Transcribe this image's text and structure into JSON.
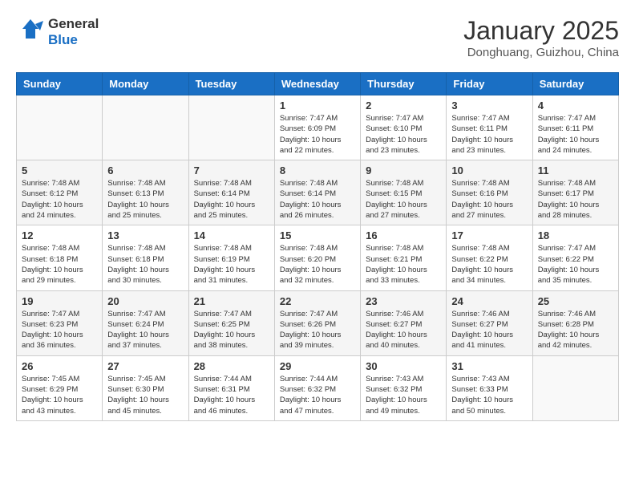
{
  "header": {
    "logo_line1": "General",
    "logo_line2": "Blue",
    "month_year": "January 2025",
    "location": "Donghuang, Guizhou, China"
  },
  "days_of_week": [
    "Sunday",
    "Monday",
    "Tuesday",
    "Wednesday",
    "Thursday",
    "Friday",
    "Saturday"
  ],
  "weeks": [
    [
      {
        "day": "",
        "info": ""
      },
      {
        "day": "",
        "info": ""
      },
      {
        "day": "",
        "info": ""
      },
      {
        "day": "1",
        "info": "Sunrise: 7:47 AM\nSunset: 6:09 PM\nDaylight: 10 hours\nand 22 minutes."
      },
      {
        "day": "2",
        "info": "Sunrise: 7:47 AM\nSunset: 6:10 PM\nDaylight: 10 hours\nand 23 minutes."
      },
      {
        "day": "3",
        "info": "Sunrise: 7:47 AM\nSunset: 6:11 PM\nDaylight: 10 hours\nand 23 minutes."
      },
      {
        "day": "4",
        "info": "Sunrise: 7:47 AM\nSunset: 6:11 PM\nDaylight: 10 hours\nand 24 minutes."
      }
    ],
    [
      {
        "day": "5",
        "info": "Sunrise: 7:48 AM\nSunset: 6:12 PM\nDaylight: 10 hours\nand 24 minutes."
      },
      {
        "day": "6",
        "info": "Sunrise: 7:48 AM\nSunset: 6:13 PM\nDaylight: 10 hours\nand 25 minutes."
      },
      {
        "day": "7",
        "info": "Sunrise: 7:48 AM\nSunset: 6:14 PM\nDaylight: 10 hours\nand 25 minutes."
      },
      {
        "day": "8",
        "info": "Sunrise: 7:48 AM\nSunset: 6:14 PM\nDaylight: 10 hours\nand 26 minutes."
      },
      {
        "day": "9",
        "info": "Sunrise: 7:48 AM\nSunset: 6:15 PM\nDaylight: 10 hours\nand 27 minutes."
      },
      {
        "day": "10",
        "info": "Sunrise: 7:48 AM\nSunset: 6:16 PM\nDaylight: 10 hours\nand 27 minutes."
      },
      {
        "day": "11",
        "info": "Sunrise: 7:48 AM\nSunset: 6:17 PM\nDaylight: 10 hours\nand 28 minutes."
      }
    ],
    [
      {
        "day": "12",
        "info": "Sunrise: 7:48 AM\nSunset: 6:18 PM\nDaylight: 10 hours\nand 29 minutes."
      },
      {
        "day": "13",
        "info": "Sunrise: 7:48 AM\nSunset: 6:18 PM\nDaylight: 10 hours\nand 30 minutes."
      },
      {
        "day": "14",
        "info": "Sunrise: 7:48 AM\nSunset: 6:19 PM\nDaylight: 10 hours\nand 31 minutes."
      },
      {
        "day": "15",
        "info": "Sunrise: 7:48 AM\nSunset: 6:20 PM\nDaylight: 10 hours\nand 32 minutes."
      },
      {
        "day": "16",
        "info": "Sunrise: 7:48 AM\nSunset: 6:21 PM\nDaylight: 10 hours\nand 33 minutes."
      },
      {
        "day": "17",
        "info": "Sunrise: 7:48 AM\nSunset: 6:22 PM\nDaylight: 10 hours\nand 34 minutes."
      },
      {
        "day": "18",
        "info": "Sunrise: 7:47 AM\nSunset: 6:22 PM\nDaylight: 10 hours\nand 35 minutes."
      }
    ],
    [
      {
        "day": "19",
        "info": "Sunrise: 7:47 AM\nSunset: 6:23 PM\nDaylight: 10 hours\nand 36 minutes."
      },
      {
        "day": "20",
        "info": "Sunrise: 7:47 AM\nSunset: 6:24 PM\nDaylight: 10 hours\nand 37 minutes."
      },
      {
        "day": "21",
        "info": "Sunrise: 7:47 AM\nSunset: 6:25 PM\nDaylight: 10 hours\nand 38 minutes."
      },
      {
        "day": "22",
        "info": "Sunrise: 7:47 AM\nSunset: 6:26 PM\nDaylight: 10 hours\nand 39 minutes."
      },
      {
        "day": "23",
        "info": "Sunrise: 7:46 AM\nSunset: 6:27 PM\nDaylight: 10 hours\nand 40 minutes."
      },
      {
        "day": "24",
        "info": "Sunrise: 7:46 AM\nSunset: 6:27 PM\nDaylight: 10 hours\nand 41 minutes."
      },
      {
        "day": "25",
        "info": "Sunrise: 7:46 AM\nSunset: 6:28 PM\nDaylight: 10 hours\nand 42 minutes."
      }
    ],
    [
      {
        "day": "26",
        "info": "Sunrise: 7:45 AM\nSunset: 6:29 PM\nDaylight: 10 hours\nand 43 minutes."
      },
      {
        "day": "27",
        "info": "Sunrise: 7:45 AM\nSunset: 6:30 PM\nDaylight: 10 hours\nand 45 minutes."
      },
      {
        "day": "28",
        "info": "Sunrise: 7:44 AM\nSunset: 6:31 PM\nDaylight: 10 hours\nand 46 minutes."
      },
      {
        "day": "29",
        "info": "Sunrise: 7:44 AM\nSunset: 6:32 PM\nDaylight: 10 hours\nand 47 minutes."
      },
      {
        "day": "30",
        "info": "Sunrise: 7:43 AM\nSunset: 6:32 PM\nDaylight: 10 hours\nand 49 minutes."
      },
      {
        "day": "31",
        "info": "Sunrise: 7:43 AM\nSunset: 6:33 PM\nDaylight: 10 hours\nand 50 minutes."
      },
      {
        "day": "",
        "info": ""
      }
    ]
  ]
}
